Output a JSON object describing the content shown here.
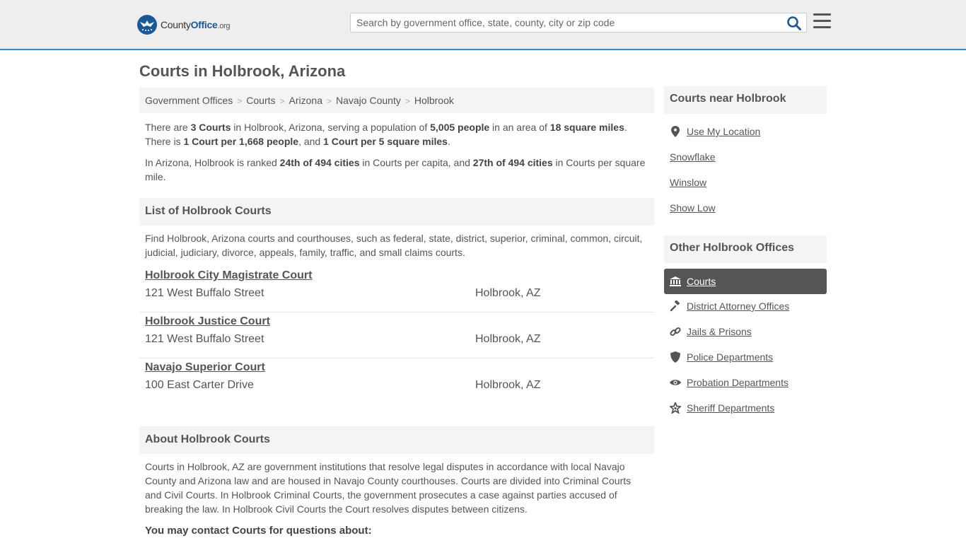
{
  "header": {
    "logo": {
      "county": "County",
      "office": "Office",
      "tld": ".org"
    },
    "search_placeholder": "Search by government office, state, county, city or zip code"
  },
  "page_title": "Courts in Holbrook, Arizona",
  "breadcrumb": [
    "Government Offices",
    "Courts",
    "Arizona",
    "Navajo County",
    "Holbrook"
  ],
  "intro": {
    "p1": {
      "t1": "There are ",
      "b1": "3 Courts",
      "t2": " in Holbrook, Arizona, serving a population of ",
      "b2": "5,005 people",
      "t3": " in an area of ",
      "b3": "18 square miles",
      "t4": ". There is ",
      "b4": "1 Court per 1,668 people",
      "t5": ", and ",
      "b5": "1 Court per 5 square miles",
      "t6": "."
    },
    "p2": {
      "t1": "In Arizona, Holbrook is ranked ",
      "b1": "24th of 494 cities",
      "t2": " in Courts per capita, and ",
      "b2": "27th of 494 cities",
      "t3": " in Courts per square mile."
    }
  },
  "list_section": {
    "heading": "List of Holbrook Courts",
    "description": "Find Holbrook, Arizona courts and courthouses, such as federal, state, district, superior, criminal, common, circuit, judicial, judiciary, divorce, appeals, family, traffic, and small claims courts.",
    "courts": [
      {
        "name": "Holbrook City Magistrate Court",
        "address": "121 West Buffalo Street",
        "city": "Holbrook, AZ"
      },
      {
        "name": "Holbrook Justice Court",
        "address": "121 West Buffalo Street",
        "city": "Holbrook, AZ"
      },
      {
        "name": "Navajo Superior Court",
        "address": "100 East Carter Drive",
        "city": "Holbrook, AZ"
      }
    ]
  },
  "about_section": {
    "heading": "About Holbrook Courts",
    "text": "Courts in Holbrook, AZ are government institutions that resolve legal disputes in accordance with local Navajo County and Arizona law and are housed in Navajo County courthouses. Courts are divided into Criminal Courts and Civil Courts. In Holbrook Criminal Courts, the government prosecutes a case against parties accused of breaking the law. In Holbrook Civil Courts the Court resolves disputes between citizens.",
    "contact_question": "You may contact Courts for questions about:"
  },
  "sidebar": {
    "near_heading": "Courts near Holbrook",
    "near_links": [
      "Use My Location",
      "Snowflake",
      "Winslow",
      "Show Low"
    ],
    "other_heading": "Other Holbrook Offices",
    "active_office": "Courts",
    "offices": [
      {
        "label": "District Attorney Offices",
        "icon": "gavel-icon"
      },
      {
        "label": "Jails & Prisons",
        "icon": "chain-link-icon"
      },
      {
        "label": "Police Departments",
        "icon": "shield-icon"
      },
      {
        "label": "Probation Departments",
        "icon": "eye-icon"
      },
      {
        "label": "Sheriff Departments",
        "icon": "sheriff-star-icon"
      }
    ]
  },
  "colors": {
    "accent": "#3b87c8",
    "logo_blue": "#1b5a96",
    "active_bg": "#555555",
    "panel_bg": "#f4f4f4"
  }
}
